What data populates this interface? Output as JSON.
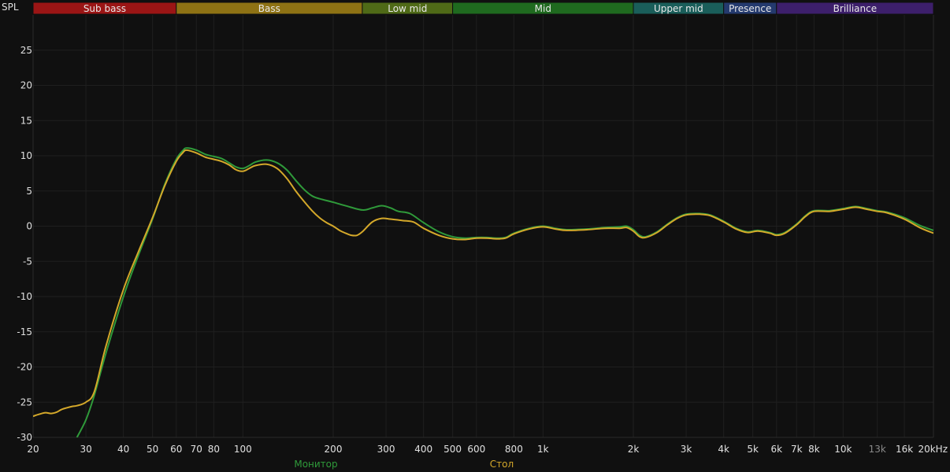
{
  "chart_data": {
    "type": "line",
    "ylabel": "SPL",
    "xlabel": "",
    "x_scale": "log",
    "xlim": [
      20,
      20000
    ],
    "ylim": [
      -30,
      30
    ],
    "grid": true,
    "x_ticks": [
      {
        "value": 20,
        "label": "20"
      },
      {
        "value": 30,
        "label": "30"
      },
      {
        "value": 40,
        "label": "40"
      },
      {
        "value": 50,
        "label": "50"
      },
      {
        "value": 60,
        "label": "60"
      },
      {
        "value": 70,
        "label": "70"
      },
      {
        "value": 80,
        "label": "80"
      },
      {
        "value": 100,
        "label": "100"
      },
      {
        "value": 200,
        "label": "200"
      },
      {
        "value": 300,
        "label": "300"
      },
      {
        "value": 400,
        "label": "400"
      },
      {
        "value": 500,
        "label": "500"
      },
      {
        "value": 600,
        "label": "600"
      },
      {
        "value": 800,
        "label": "800"
      },
      {
        "value": 1000,
        "label": "1k"
      },
      {
        "value": 2000,
        "label": "2k"
      },
      {
        "value": 3000,
        "label": "3k"
      },
      {
        "value": 4000,
        "label": "4k"
      },
      {
        "value": 5000,
        "label": "5k"
      },
      {
        "value": 6000,
        "label": "6k"
      },
      {
        "value": 7000,
        "label": "7k"
      },
      {
        "value": 8000,
        "label": "8k"
      },
      {
        "value": 10000,
        "label": "10k"
      },
      {
        "value": 13000,
        "label": "13k",
        "dim": true
      },
      {
        "value": 16000,
        "label": "16k"
      },
      {
        "value": 20000,
        "label": "20kHz"
      }
    ],
    "y_ticks": [
      25,
      20,
      15,
      10,
      5,
      0,
      -5,
      -10,
      -15,
      -20,
      -25,
      -30
    ],
    "bands": [
      {
        "name": "Sub bass",
        "from": 20,
        "to": 60,
        "color": "#9b1515"
      },
      {
        "name": "Bass",
        "from": 60,
        "to": 250,
        "color": "#8e7214"
      },
      {
        "name": "Low mid",
        "from": 250,
        "to": 500,
        "color": "#4f6a17"
      },
      {
        "name": "Mid",
        "from": 500,
        "to": 2000,
        "color": "#1f6a1f"
      },
      {
        "name": "Upper mid",
        "from": 2000,
        "to": 4000,
        "color": "#1a5e5a"
      },
      {
        "name": "Presence",
        "from": 4000,
        "to": 6000,
        "color": "#243a6e"
      },
      {
        "name": "Brilliance",
        "from": 6000,
        "to": 20000,
        "color": "#3d1f6b"
      }
    ],
    "series": [
      {
        "name": "Монитор",
        "color": "#2f9a3a",
        "points": [
          [
            28,
            -30
          ],
          [
            30,
            -27.5
          ],
          [
            32,
            -24
          ],
          [
            35,
            -18
          ],
          [
            40,
            -10
          ],
          [
            45,
            -4
          ],
          [
            50,
            1
          ],
          [
            55,
            6
          ],
          [
            60,
            9.5
          ],
          [
            63,
            10.7
          ],
          [
            65,
            11.1
          ],
          [
            70,
            10.8
          ],
          [
            75,
            10.2
          ],
          [
            80,
            9.9
          ],
          [
            85,
            9.6
          ],
          [
            90,
            9
          ],
          [
            95,
            8.4
          ],
          [
            100,
            8.2
          ],
          [
            105,
            8.6
          ],
          [
            110,
            9.1
          ],
          [
            120,
            9.4
          ],
          [
            130,
            9
          ],
          [
            140,
            8
          ],
          [
            150,
            6.5
          ],
          [
            160,
            5.2
          ],
          [
            170,
            4.3
          ],
          [
            180,
            3.9
          ],
          [
            200,
            3.4
          ],
          [
            220,
            2.9
          ],
          [
            250,
            2.3
          ],
          [
            270,
            2.6
          ],
          [
            290,
            2.9
          ],
          [
            310,
            2.6
          ],
          [
            330,
            2.1
          ],
          [
            360,
            1.8
          ],
          [
            400,
            0.5
          ],
          [
            450,
            -0.8
          ],
          [
            500,
            -1.5
          ],
          [
            550,
            -1.7
          ],
          [
            600,
            -1.6
          ],
          [
            650,
            -1.6
          ],
          [
            700,
            -1.7
          ],
          [
            750,
            -1.6
          ],
          [
            800,
            -1
          ],
          [
            900,
            -0.3
          ],
          [
            1000,
            0
          ],
          [
            1100,
            -0.3
          ],
          [
            1200,
            -0.5
          ],
          [
            1400,
            -0.4
          ],
          [
            1600,
            -0.2
          ],
          [
            1800,
            -0.1
          ],
          [
            1900,
            0
          ],
          [
            2000,
            -0.5
          ],
          [
            2100,
            -1.3
          ],
          [
            2200,
            -1.5
          ],
          [
            2400,
            -0.8
          ],
          [
            2600,
            0.3
          ],
          [
            2800,
            1.2
          ],
          [
            3000,
            1.7
          ],
          [
            3300,
            1.8
          ],
          [
            3600,
            1.6
          ],
          [
            4000,
            0.7
          ],
          [
            4400,
            -0.3
          ],
          [
            4800,
            -0.8
          ],
          [
            5200,
            -0.6
          ],
          [
            5700,
            -0.9
          ],
          [
            6000,
            -1.2
          ],
          [
            6400,
            -0.9
          ],
          [
            7000,
            0.3
          ],
          [
            7500,
            1.5
          ],
          [
            8000,
            2.2
          ],
          [
            9000,
            2.2
          ],
          [
            10000,
            2.5
          ],
          [
            11000,
            2.8
          ],
          [
            12000,
            2.5
          ],
          [
            13000,
            2.2
          ],
          [
            14000,
            2
          ],
          [
            16000,
            1.2
          ],
          [
            18000,
            0.1
          ],
          [
            20000,
            -0.6
          ]
        ]
      },
      {
        "name": "Стол",
        "color": "#d4a82a",
        "points": [
          [
            20,
            -27
          ],
          [
            21,
            -26.7
          ],
          [
            22,
            -26.5
          ],
          [
            23,
            -26.6
          ],
          [
            24,
            -26.4
          ],
          [
            25,
            -26
          ],
          [
            27,
            -25.6
          ],
          [
            28,
            -25.5
          ],
          [
            30,
            -25
          ],
          [
            32,
            -23.5
          ],
          [
            35,
            -17
          ],
          [
            40,
            -9
          ],
          [
            45,
            -3.5
          ],
          [
            50,
            1.2
          ],
          [
            55,
            5.8
          ],
          [
            60,
            9.2
          ],
          [
            63,
            10.4
          ],
          [
            65,
            10.8
          ],
          [
            70,
            10.4
          ],
          [
            75,
            9.8
          ],
          [
            80,
            9.5
          ],
          [
            85,
            9.2
          ],
          [
            90,
            8.7
          ],
          [
            95,
            8
          ],
          [
            100,
            7.8
          ],
          [
            105,
            8.2
          ],
          [
            110,
            8.6
          ],
          [
            120,
            8.8
          ],
          [
            130,
            8.2
          ],
          [
            140,
            6.8
          ],
          [
            150,
            5
          ],
          [
            160,
            3.5
          ],
          [
            170,
            2.2
          ],
          [
            180,
            1.2
          ],
          [
            190,
            0.5
          ],
          [
            200,
            0
          ],
          [
            210,
            -0.6
          ],
          [
            220,
            -1
          ],
          [
            230,
            -1.3
          ],
          [
            240,
            -1.3
          ],
          [
            250,
            -0.8
          ],
          [
            270,
            0.6
          ],
          [
            290,
            1.1
          ],
          [
            310,
            1
          ],
          [
            340,
            0.8
          ],
          [
            370,
            0.6
          ],
          [
            400,
            -0.3
          ],
          [
            450,
            -1.3
          ],
          [
            500,
            -1.8
          ],
          [
            550,
            -1.9
          ],
          [
            600,
            -1.7
          ],
          [
            650,
            -1.7
          ],
          [
            700,
            -1.8
          ],
          [
            750,
            -1.7
          ],
          [
            800,
            -1.1
          ],
          [
            900,
            -0.4
          ],
          [
            1000,
            -0.1
          ],
          [
            1100,
            -0.4
          ],
          [
            1200,
            -0.6
          ],
          [
            1400,
            -0.5
          ],
          [
            1600,
            -0.3
          ],
          [
            1800,
            -0.3
          ],
          [
            1900,
            -0.2
          ],
          [
            2000,
            -0.7
          ],
          [
            2100,
            -1.5
          ],
          [
            2200,
            -1.6
          ],
          [
            2400,
            -0.9
          ],
          [
            2600,
            0.2
          ],
          [
            2800,
            1.1
          ],
          [
            3000,
            1.6
          ],
          [
            3300,
            1.7
          ],
          [
            3600,
            1.5
          ],
          [
            4000,
            0.6
          ],
          [
            4400,
            -0.4
          ],
          [
            4800,
            -0.9
          ],
          [
            5200,
            -0.7
          ],
          [
            5700,
            -1
          ],
          [
            6000,
            -1.3
          ],
          [
            6400,
            -1
          ],
          [
            7000,
            0.2
          ],
          [
            7500,
            1.4
          ],
          [
            8000,
            2.1
          ],
          [
            9000,
            2.1
          ],
          [
            10000,
            2.4
          ],
          [
            11000,
            2.7
          ],
          [
            12000,
            2.4
          ],
          [
            13000,
            2.1
          ],
          [
            14000,
            1.9
          ],
          [
            16000,
            1
          ],
          [
            18000,
            -0.2
          ],
          [
            20000,
            -1
          ]
        ]
      }
    ]
  }
}
